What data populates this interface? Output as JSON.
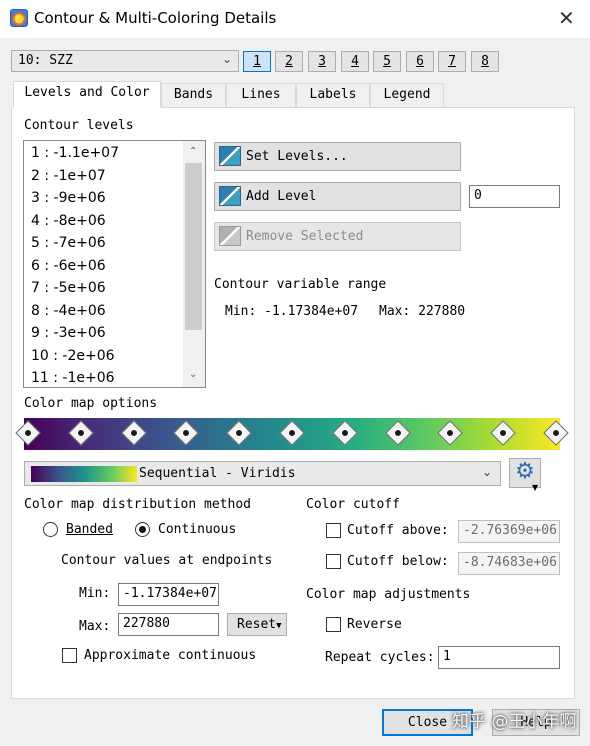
{
  "window": {
    "title": "Contour & Multi-Coloring Details"
  },
  "zone": {
    "selected": "10: SZZ"
  },
  "frames": [
    "1",
    "2",
    "3",
    "4",
    "5",
    "6",
    "7",
    "8"
  ],
  "tabs": [
    "Levels and Color",
    "Bands",
    "Lines",
    "Labels",
    "Legend"
  ],
  "levels": {
    "section_label": "Contour levels",
    "items": [
      "1 : -1.1e+07",
      "2 : -1e+07",
      "3 : -9e+06",
      "4 : -8e+06",
      "5 : -7e+06",
      "6 : -6e+06",
      "7 : -5e+06",
      "8 : -4e+06",
      "9 : -3e+06",
      "10 : -2e+06",
      "11 : -1e+06"
    ],
    "set_levels_label": "Set Levels...",
    "add_level_label": "Add Level",
    "add_level_value": "0",
    "remove_selected_label": "Remove Selected",
    "range_label": "Contour variable range",
    "range_min": "Min: -1.17384e+07",
    "range_max": "Max: 227880"
  },
  "colormap": {
    "section_label": "Color map options",
    "handle_count": 11,
    "selected": "Sequential - Viridis",
    "distribution_label": "Color map distribution method",
    "banded_label": "Banded",
    "continuous_label": "Continuous",
    "selected_method": "Continuous",
    "endpoints_label": "Contour values at endpoints",
    "min_label": "Min:",
    "min_value": "-1.17384e+07",
    "max_label": "Max:",
    "max_value": "227880",
    "reset_label": "Reset",
    "approx_label": "Approximate continuous",
    "approx_checked": false
  },
  "cutoff": {
    "section_label": "Color cutoff",
    "above_label": "Cutoff above:",
    "above_value": "-2.76369e+06",
    "above_checked": false,
    "below_label": "Cutoff below:",
    "below_value": "-8.74683e+06",
    "below_checked": false
  },
  "adjustments": {
    "section_label": "Color map adjustments",
    "reverse_label": "Reverse",
    "reverse_checked": false,
    "repeat_label": "Repeat cycles:",
    "repeat_value": "1"
  },
  "footer": {
    "close_label": "Close",
    "help_label": "Help",
    "watermark": "知乎 @王小年啊"
  },
  "colors": {
    "accent": "#0078d7",
    "viridis": [
      "#440154",
      "#3b528b",
      "#21918c",
      "#5ec962",
      "#fde725"
    ]
  }
}
